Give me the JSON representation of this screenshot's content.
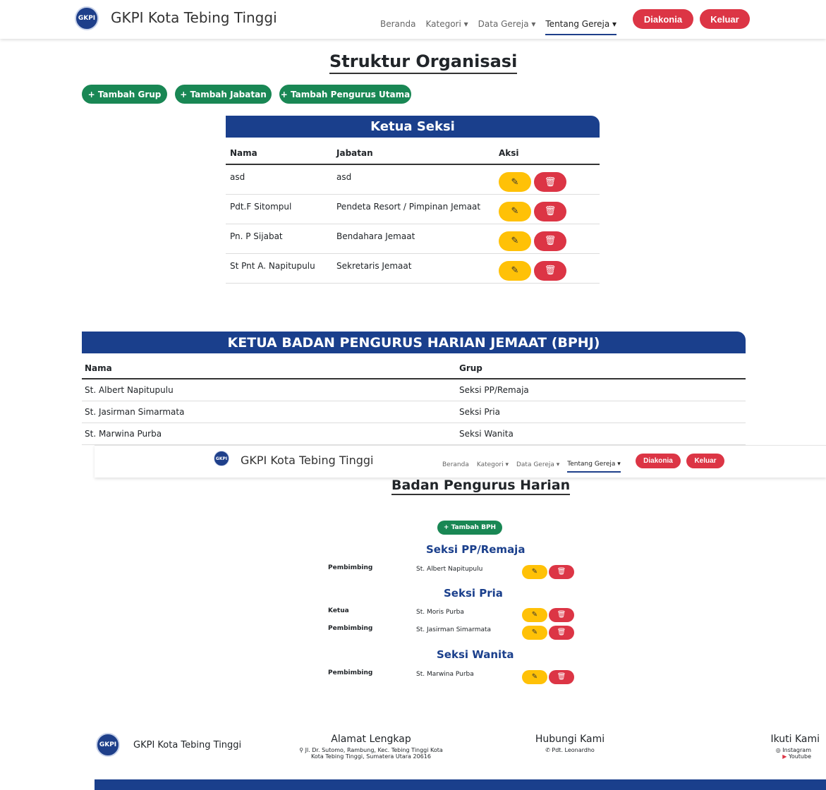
{
  "nav": {
    "brand": "GKPI Kota Tebing Tinggi",
    "logo_text": "GKPI",
    "links": [
      "Beranda",
      "Kategori ▾",
      "Data Gereja ▾",
      "Tentang Gereja ▾"
    ],
    "diakonia": "Diakonia",
    "keluar": "Keluar"
  },
  "page_title": "Struktur Organisasi",
  "actions": [
    "+ Tambah Grup",
    "+ Tambah Jabatan",
    "+ Tambah Pengurus Utama"
  ],
  "ketua_seksi": {
    "title": "Ketua Seksi",
    "headers": [
      "Nama",
      "Jabatan",
      "Aksi"
    ],
    "rows": [
      {
        "nama": "asd",
        "jabatan": "asd"
      },
      {
        "nama": "Pdt.F Sitompul",
        "jabatan": "Pendeta Resort / Pimpinan Jemaat"
      },
      {
        "nama": "Pn. P Sijabat",
        "jabatan": "Bendahara Jemaat"
      },
      {
        "nama": "St Pnt A. Napitupulu",
        "jabatan": "Sekretaris Jemaat"
      }
    ]
  },
  "bphj": {
    "title": "KETUA BADAN PENGURUS HARIAN JEMAAT (BPHJ)",
    "headers": [
      "Nama",
      "Grup"
    ],
    "rows": [
      {
        "nama": "St. Albert Napitupulu",
        "grup": "Seksi PP/Remaja"
      },
      {
        "nama": "St. Jasirman Simarmata",
        "grup": "Seksi Pria"
      },
      {
        "nama": "St. Marwina Purba",
        "grup": "Seksi Wanita"
      }
    ]
  },
  "bph": {
    "title": "Badan Pengurus Harian",
    "add_button": "+ Tambah BPH",
    "sections": [
      {
        "name": "Seksi PP/Remaja",
        "members": [
          {
            "role": "Pembimbing",
            "name": "St. Albert Napitupulu"
          }
        ]
      },
      {
        "name": "Seksi Pria",
        "members": [
          {
            "role": "Ketua",
            "name": "St. Moris Purba"
          },
          {
            "role": "Pembimbing",
            "name": "St. Jasirman Simarmata"
          }
        ]
      },
      {
        "name": "Seksi Wanita",
        "members": [
          {
            "role": "Pembimbing",
            "name": "St. Marwina Purba"
          }
        ]
      }
    ]
  },
  "footer": {
    "brand": "GKPI Kota Tebing Tinggi",
    "alamat_title": "Alamat Lengkap",
    "alamat_line1": "Jl. Dr. Sutomo, Rambung, Kec. Tebing Tinggi Kota",
    "alamat_line2": "Kota Tebing Tinggi, Sumatera Utara 20616",
    "hubungi_title": "Hubungi Kami",
    "hubungi_contact": "Pdt. Leonardho",
    "ikuti_title": "Ikuti Kami",
    "instagram": "Instagram",
    "youtube": "Youtube"
  },
  "icons": {
    "edit": "pencil-square-icon",
    "delete": "trash-icon",
    "location": "map-pin-icon",
    "phone": "phone-icon",
    "instagram": "instagram-icon",
    "youtube": "youtube-icon"
  },
  "colors": {
    "primary_blue": "#1a3f8c",
    "danger_red": "#dc3545",
    "success_green": "#198754",
    "warning_yellow": "#ffc107"
  }
}
